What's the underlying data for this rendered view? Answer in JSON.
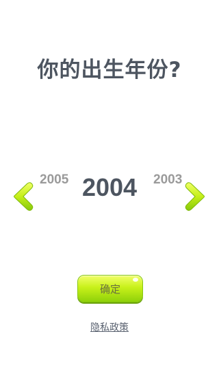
{
  "title": "你的出生年份?",
  "year_picker": {
    "previous": "2005",
    "current": "2004",
    "next": "2003",
    "left_arrow_icon": "chevron-left-icon",
    "right_arrow_icon": "chevron-right-icon"
  },
  "confirm_label": "确定",
  "privacy_link": "隐私政策",
  "colors": {
    "title": "#4d5560",
    "side_years": "#9a9a9a",
    "accent_green": "#b8ea12",
    "link": "#5a6270"
  }
}
